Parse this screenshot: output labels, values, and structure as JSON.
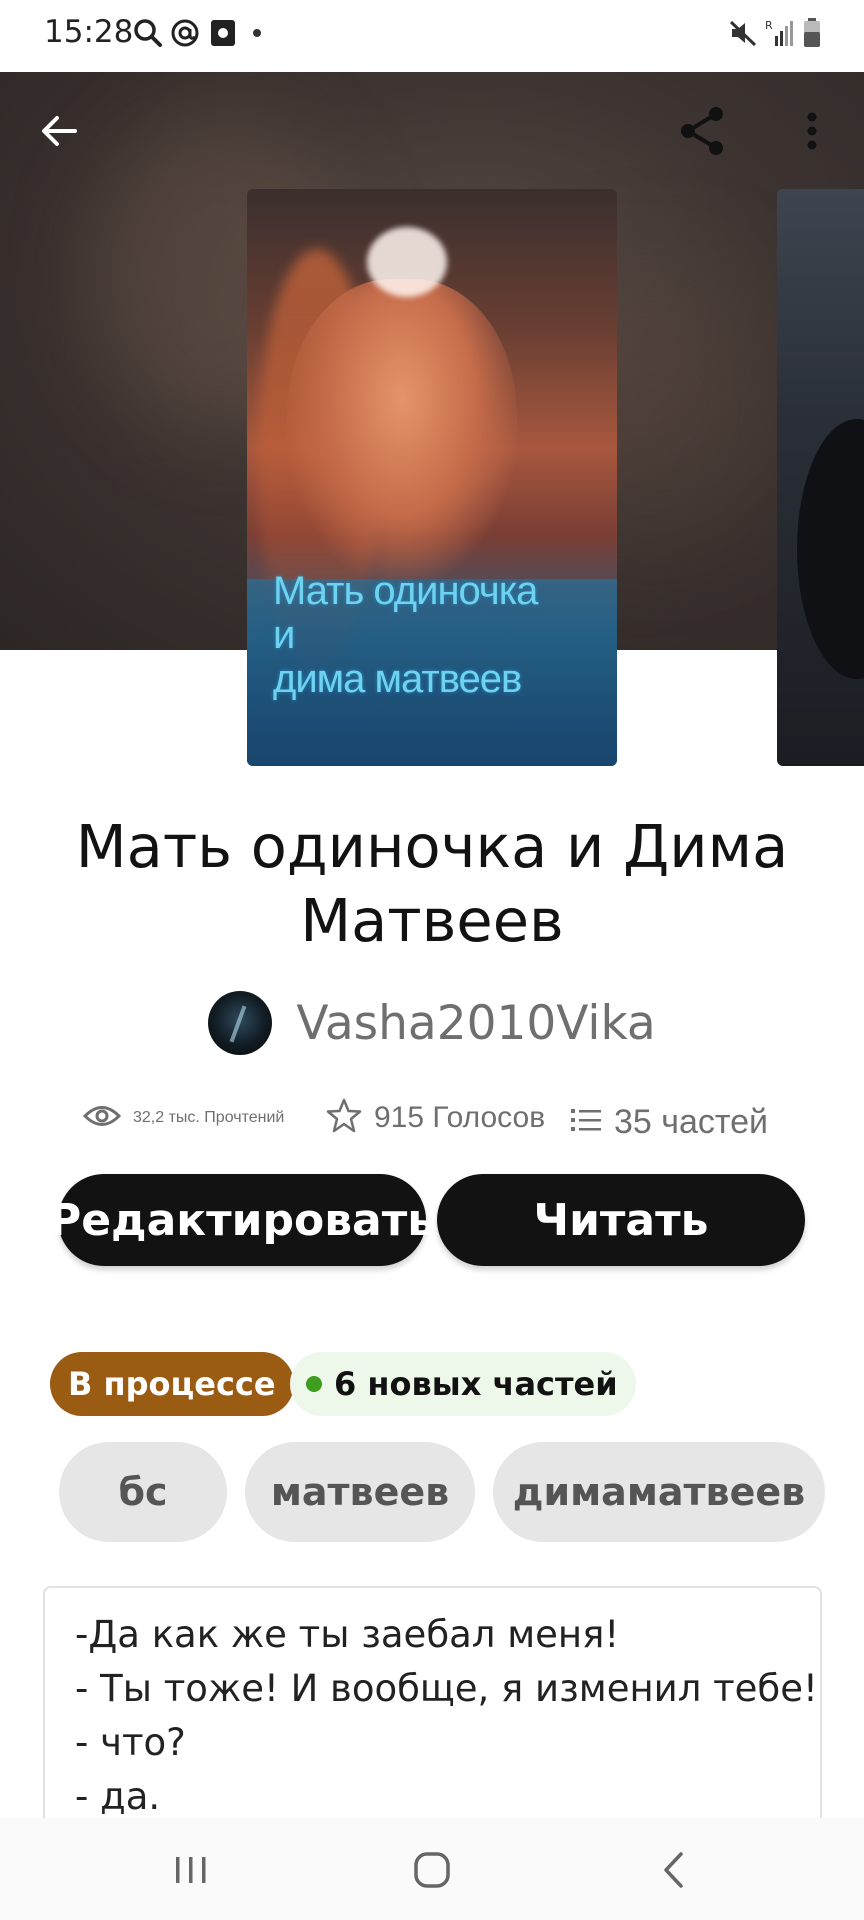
{
  "status_bar": {
    "time": "15:28",
    "icons": [
      "search-icon",
      "at-sign-icon",
      "box-app-icon",
      "dot-icon",
      "mute-icon",
      "signal-icon",
      "battery-icon"
    ]
  },
  "header": {
    "back_icon": "arrow-left-icon",
    "share_icon": "share-icon",
    "more_icon": "more-vert-icon"
  },
  "cover": {
    "title_lines": [
      "Мать одиночка",
      "и",
      "дима матвеев"
    ]
  },
  "story": {
    "title": "Мать одиночка и Дима Матвеев",
    "author": "Vasha2010Vika"
  },
  "stats": {
    "reads": "32,2 тыс. Прочтений",
    "votes": "915 Голосов",
    "parts": "35 частей"
  },
  "buttons": {
    "edit": "Редактировать",
    "read": "Читать"
  },
  "status_chips": {
    "status": "В процессе",
    "new_parts": "6 новых частей"
  },
  "tags": [
    "бс",
    "матвеев",
    "димаматвеев"
  ],
  "description_lines": [
    "-Да как же ты заебал меня!",
    "- Ты тоже! И вообще, я изменил тебе!",
    "- что?",
    "- да."
  ],
  "nav_bar": {
    "icons": [
      "recent-apps-icon",
      "home-icon",
      "back-chevron-icon"
    ]
  },
  "colors": {
    "button_bg": "#121212",
    "status_chip_bg": "#9a5b12",
    "new_chip_bg": "#eef8ea",
    "new_dot": "#3c9d1f",
    "tag_bg": "#e6e6e6"
  }
}
